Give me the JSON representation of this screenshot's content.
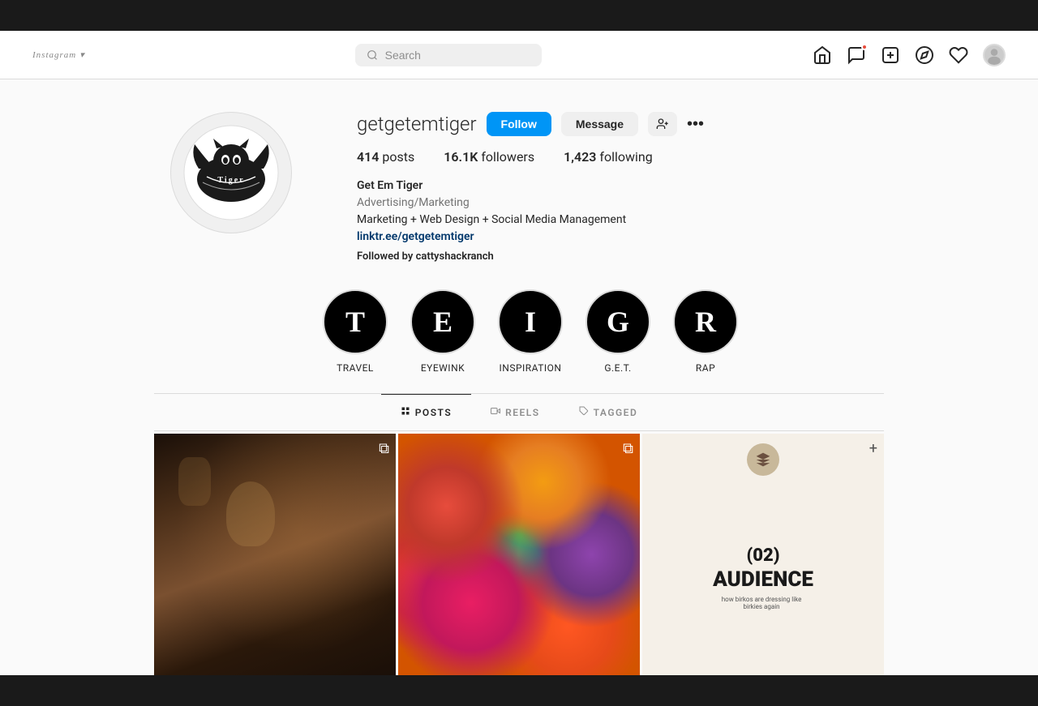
{
  "browser": {
    "top_bar_height": 38,
    "bottom_bar_height": 38
  },
  "nav": {
    "logo": "Instagram",
    "logo_chevron": "▾",
    "search_placeholder": "Search",
    "icons": {
      "home": "home-icon",
      "messenger": "messenger-icon",
      "add": "add-icon",
      "explore": "explore-icon",
      "heart": "heart-icon",
      "avatar": "avatar-icon"
    }
  },
  "profile": {
    "username": "getgetemtiger",
    "stats": {
      "posts_count": "414",
      "posts_label": "posts",
      "followers_count": "16.1K",
      "followers_label": "followers",
      "following_count": "1,423",
      "following_label": "following"
    },
    "buttons": {
      "follow": "Follow",
      "message": "Message"
    },
    "bio": {
      "name": "Get Em Tiger",
      "category": "Advertising/Marketing",
      "description": "Marketing + Web Design + Social Media Management",
      "link": "linktr.ee/getgetemtiger",
      "followed_by_prefix": "Followed by ",
      "followed_by_user": "cattyshackranch"
    }
  },
  "highlights": [
    {
      "letter": "T",
      "label": "TRAVEL"
    },
    {
      "letter": "E",
      "label": "EYEWINK"
    },
    {
      "letter": "I",
      "label": "INSPIRATION"
    },
    {
      "letter": "G",
      "label": "G.E.T."
    },
    {
      "letter": "R",
      "label": "RAP"
    }
  ],
  "tabs": [
    {
      "id": "posts",
      "label": "POSTS",
      "icon": "▦",
      "active": true
    },
    {
      "id": "reels",
      "label": "REELS",
      "icon": "▶",
      "active": false
    },
    {
      "id": "tagged",
      "label": "TAGGED",
      "icon": "◉",
      "active": false
    }
  ],
  "grid": {
    "posts": [
      {
        "id": 1,
        "type": "painting",
        "has_icon": true,
        "icon": "⊞"
      },
      {
        "id": 2,
        "type": "flowers",
        "has_icon": true,
        "icon": "⊞"
      },
      {
        "id": 3,
        "type": "text",
        "num": "(02)",
        "title": "AUDIENCE",
        "sub": "how birkos are dressing like birkies again",
        "has_icon": true,
        "icon": "+"
      }
    ]
  },
  "colors": {
    "follow_btn": "#0095f6",
    "link_color": "#00376b",
    "border": "#dbdbdb",
    "text_primary": "#262626",
    "text_secondary": "#8e8e8e"
  }
}
